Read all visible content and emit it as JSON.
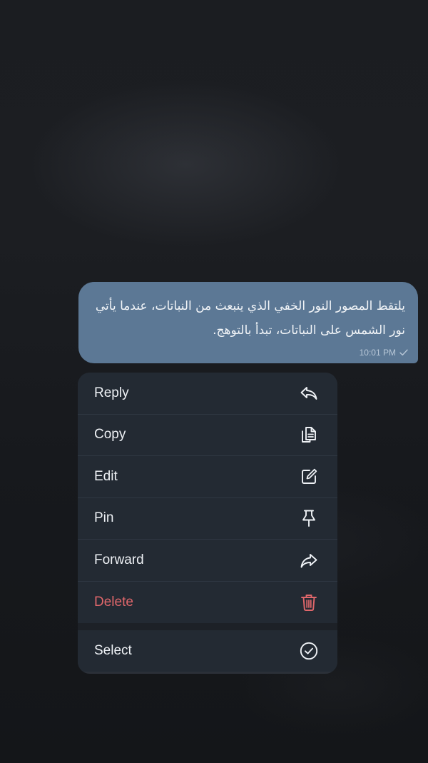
{
  "message": {
    "text": "يلتقط المصور النور الخفي الذي ينبعث من النباتات، عندما يأتي نور الشمس على النباتات، تبدأ بالتوهج.",
    "time": "10:01 PM",
    "status_icon": "single-check-icon"
  },
  "context_menu": {
    "items": [
      {
        "label": "Reply",
        "icon": "reply-icon"
      },
      {
        "label": "Copy",
        "icon": "copy-icon"
      },
      {
        "label": "Edit",
        "icon": "edit-icon"
      },
      {
        "label": "Pin",
        "icon": "pin-icon"
      },
      {
        "label": "Forward",
        "icon": "forward-icon"
      },
      {
        "label": "Delete",
        "icon": "trash-icon"
      }
    ],
    "select": {
      "label": "Select",
      "icon": "check-circle-icon"
    }
  },
  "colors": {
    "bubble": "#5c7895",
    "menu_background": "#232a33",
    "danger": "#e0676b",
    "text": "#eef1f5"
  }
}
